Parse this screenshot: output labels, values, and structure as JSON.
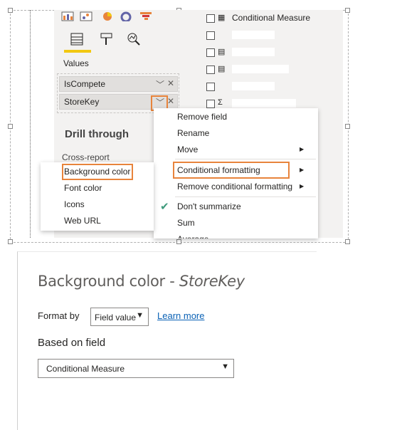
{
  "viz_pane": {
    "values_label": "Values",
    "wells": [
      {
        "label": "IsCompete"
      },
      {
        "label": "StoreKey"
      }
    ],
    "drill_through_title": "Drill through",
    "cross_report_label": "Cross-report",
    "underline_color": "#f2c811"
  },
  "fields": [
    {
      "name": "Conditional Measure",
      "icon": "calculator-icon"
    },
    {
      "name": "",
      "icon": ""
    },
    {
      "name": "",
      "icon": "date-table-icon"
    },
    {
      "name": "",
      "icon": "date-table-icon"
    },
    {
      "name": "",
      "icon": ""
    },
    {
      "name": "",
      "icon": "sigma-icon"
    }
  ],
  "context_menu": {
    "items": [
      {
        "label": "Remove field"
      },
      {
        "label": "Rename"
      },
      {
        "label": "Move"
      },
      {
        "label": "Conditional formatting"
      },
      {
        "label": "Remove conditional formatting"
      },
      {
        "label": "Don't summarize"
      },
      {
        "label": "Sum"
      },
      {
        "label": "Average"
      }
    ]
  },
  "submenu": {
    "items": [
      "Background color",
      "Font color",
      "Icons",
      "Web URL"
    ]
  },
  "dialog": {
    "title": "Background color - ",
    "title_field": "StoreKey",
    "format_by_label": "Format by",
    "format_by_value": "Field value",
    "learn_more": "Learn more",
    "based_on_label": "Based on field",
    "based_on_value": "Conditional Measure"
  },
  "colors": {
    "highlight": "#e8843c",
    "link": "#0a61b5",
    "check": "#3f9a7c"
  }
}
